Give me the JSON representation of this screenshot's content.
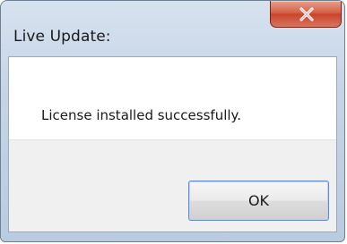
{
  "window": {
    "title": "Live Update:",
    "message": "License installed successfully.",
    "buttons": {
      "ok": "OK"
    },
    "controls": {
      "close_icon": "close-icon"
    }
  },
  "colors": {
    "title_bar": "#c6d5e7",
    "close_button": "#d56246",
    "content_background": "#ffffff",
    "footer_background": "#f0f0f0",
    "ok_border": "#5f8ad0"
  }
}
